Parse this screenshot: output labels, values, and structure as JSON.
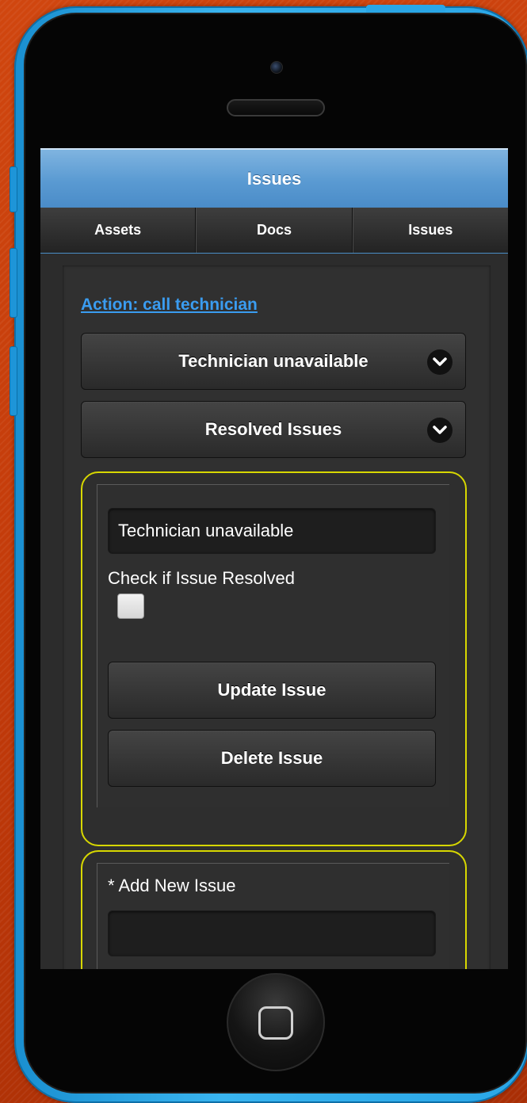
{
  "header": {
    "title": "Issues"
  },
  "tabs": [
    {
      "label": "Assets"
    },
    {
      "label": "Docs"
    },
    {
      "label": "Issues"
    }
  ],
  "action_link": "Action: call technician",
  "selects": {
    "issue_select": "Technician unavailable",
    "resolved_select": "Resolved Issues"
  },
  "issue_form": {
    "issue_value": "Technician unavailable",
    "check_label": "Check if Issue Resolved",
    "resolved_checked": false,
    "update_label": "Update Issue",
    "delete_label": "Delete Issue"
  },
  "new_issue": {
    "label": "* Add New Issue",
    "value": ""
  },
  "icons": {
    "select_chevron": "chevron-down-icon",
    "camera": "camera-icon",
    "home": "home-button-icon"
  },
  "colors": {
    "accent_blue": "#5a9ad2",
    "link_blue": "#3a9cf0",
    "card_border": "#d7d700",
    "phone_body": "#2aa6e6",
    "background": "#c23a0a"
  }
}
